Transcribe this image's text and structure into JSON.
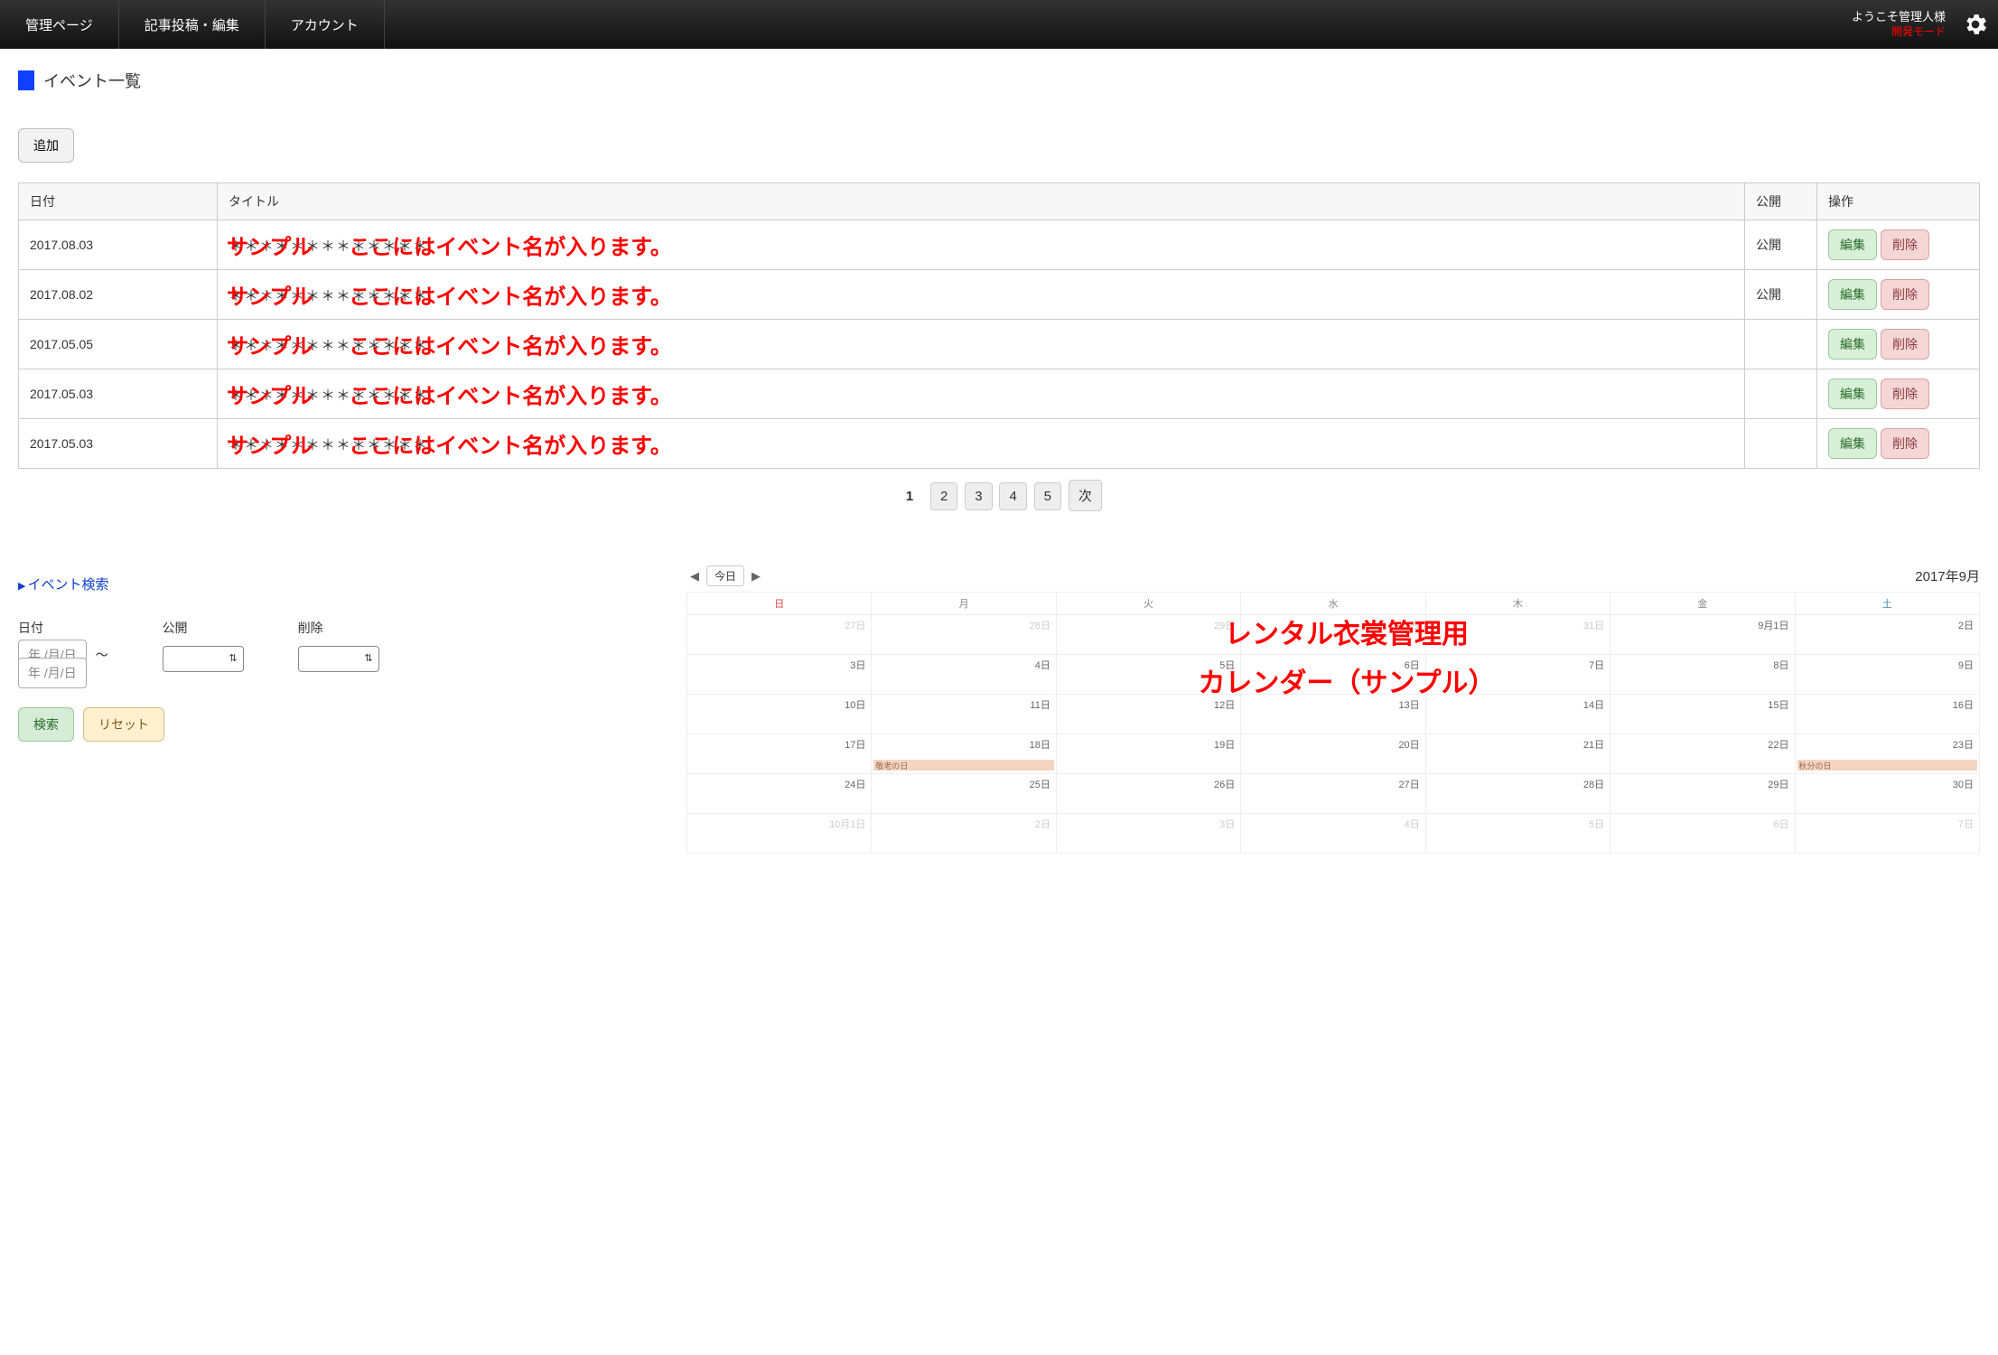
{
  "nav": {
    "items": [
      "管理ページ",
      "記事投稿・編集",
      "アカウント"
    ],
    "welcome": "ようこそ管理人様",
    "dev_mode": "開発モード"
  },
  "page_title": "イベント一覧",
  "add_button": "追加",
  "table": {
    "headers": {
      "date": "日付",
      "title": "タイトル",
      "public": "公開",
      "ops": "操作"
    },
    "edit_label": "編集",
    "delete_label": "削除",
    "sample_watermark": "サンプル",
    "sample_suffix": "ここにはイベント名が入ります。",
    "rows": [
      {
        "date": "2017.08.03",
        "stars": "＊＊＊＊＊＊＊＊＊＊＊＊＊",
        "public": "公開"
      },
      {
        "date": "2017.08.02",
        "stars": "＊＊＊＊＊＊＊＊＊＊＊＊＊",
        "public": "公開"
      },
      {
        "date": "2017.05.05",
        "stars": "＊＊＊＊＊＊＊＊＊＊＊＊＊",
        "public": ""
      },
      {
        "date": "2017.05.03",
        "stars": "＊＊＊＊＊＊＊＊＊＊＊＊＊",
        "public": ""
      },
      {
        "date": "2017.05.03",
        "stars": "＊＊＊＊＊＊＊＊＊＊＊＊＊",
        "public": ""
      }
    ]
  },
  "pagination": {
    "current": "1",
    "pages": [
      "2",
      "3",
      "4",
      "5"
    ],
    "next": "次"
  },
  "search": {
    "title": "イベント検索",
    "date_label": "日付",
    "public_label": "公開",
    "delete_label": "削除",
    "date_placeholder": "年 /月/日",
    "search_btn": "検索",
    "reset_btn": "リセット"
  },
  "calendar": {
    "today": "今日",
    "title": "2017年9月",
    "watermark_line1": "レンタル衣裳管理用",
    "watermark_line2": "カレンダー（サンプル）",
    "dow": [
      "日",
      "月",
      "火",
      "水",
      "木",
      "金",
      "土"
    ],
    "weeks": [
      [
        {
          "d": "27日",
          "out": true
        },
        {
          "d": "28日",
          "out": true
        },
        {
          "d": "29日",
          "out": true
        },
        {
          "d": "30日",
          "out": true
        },
        {
          "d": "31日",
          "out": true
        },
        {
          "d": "9月1日"
        },
        {
          "d": "2日"
        }
      ],
      [
        {
          "d": "3日"
        },
        {
          "d": "4日"
        },
        {
          "d": "5日"
        },
        {
          "d": "6日"
        },
        {
          "d": "7日"
        },
        {
          "d": "8日"
        },
        {
          "d": "9日"
        }
      ],
      [
        {
          "d": "10日"
        },
        {
          "d": "11日"
        },
        {
          "d": "12日"
        },
        {
          "d": "13日"
        },
        {
          "d": "14日"
        },
        {
          "d": "15日"
        },
        {
          "d": "16日"
        }
      ],
      [
        {
          "d": "17日"
        },
        {
          "d": "18日",
          "holiday": "敬老の日"
        },
        {
          "d": "19日"
        },
        {
          "d": "20日"
        },
        {
          "d": "21日"
        },
        {
          "d": "22日"
        },
        {
          "d": "23日",
          "holiday": "秋分の日"
        }
      ],
      [
        {
          "d": "24日"
        },
        {
          "d": "25日"
        },
        {
          "d": "26日"
        },
        {
          "d": "27日"
        },
        {
          "d": "28日"
        },
        {
          "d": "29日"
        },
        {
          "d": "30日"
        }
      ],
      [
        {
          "d": "10月1日",
          "out": true
        },
        {
          "d": "2日",
          "out": true
        },
        {
          "d": "3日",
          "out": true
        },
        {
          "d": "4日",
          "out": true
        },
        {
          "d": "5日",
          "out": true
        },
        {
          "d": "6日",
          "out": true
        },
        {
          "d": "7日",
          "out": true
        }
      ]
    ]
  }
}
